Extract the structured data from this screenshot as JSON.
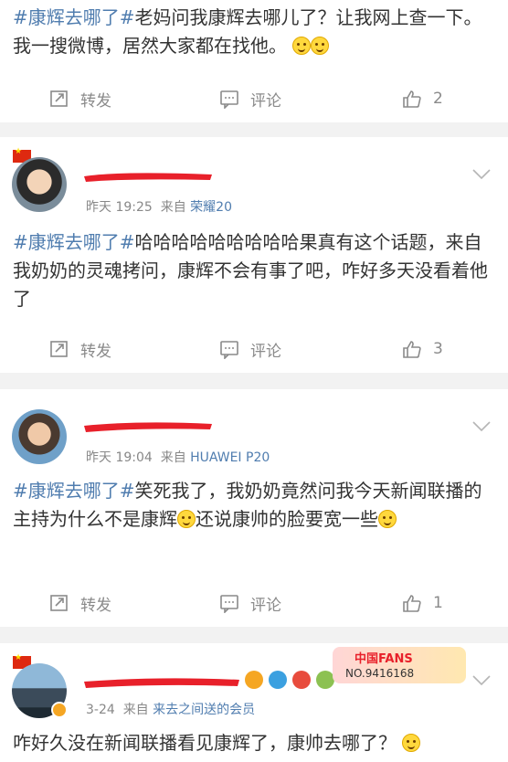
{
  "posts": [
    {
      "text_hashtag": "#康辉去哪了#",
      "text_body": "老妈问我康辉去哪儿了？让我网上查一下。我一搜微博，居然大家都在找他。",
      "actions": {
        "repost": "转发",
        "comment": "评论",
        "likes": "2"
      }
    },
    {
      "time": "昨天 19:25",
      "from": "来自",
      "source": "荣耀20",
      "text_hashtag": "#康辉去哪了#",
      "text_body": "哈哈哈哈哈哈哈哈哈果真有这个话题，来自我奶奶的灵魂拷问，康辉不会有事了吧，咋好多天没看着他了",
      "actions": {
        "repost": "转发",
        "comment": "评论",
        "likes": "3"
      }
    },
    {
      "time": "昨天 19:04",
      "from": "来自",
      "source": "HUAWEI P20",
      "text_hashtag": "#康辉去哪了#",
      "text_body_1": "笑死我了，我奶奶竟然问我今天新闻联播的主持为什么不是康辉",
      "text_body_2": "还说康帅的脸要宽一些",
      "actions": {
        "repost": "转发",
        "comment": "评论",
        "likes": "1"
      }
    },
    {
      "time": "3-24",
      "from": "来自",
      "source": "来去之间送的会员",
      "badge_title": "中国FANS",
      "badge_no": "NO.9416168",
      "text_body": "咋好久没在新闻联播看见康辉了，康帅去哪了？"
    }
  ],
  "colors": {
    "link": "#507daf",
    "redaction": "#e8202a",
    "text": "#333333",
    "meta": "#888888"
  }
}
